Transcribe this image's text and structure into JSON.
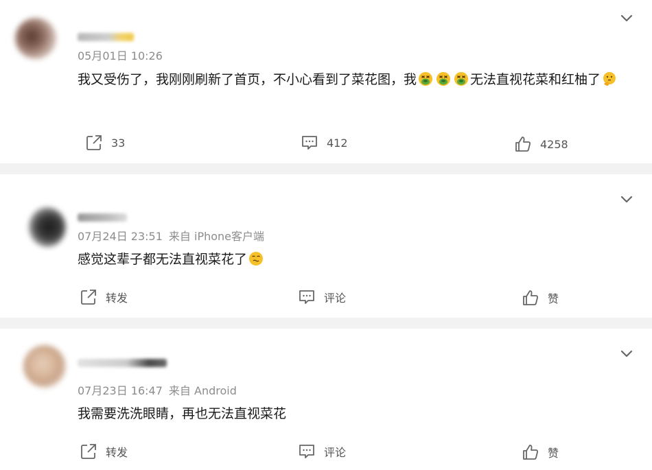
{
  "colors": {
    "separator": "#f2f2f2",
    "meta_text": "#8c8c8c",
    "action_text": "#555555",
    "icon_stroke": "#666666",
    "emoji_face": "#f5c02a",
    "emoji_sick": "#5aa83a"
  },
  "comments": [
    {
      "time": "05月01日 10:26",
      "source": "",
      "text_parts": [
        "我又受伤了，我刚刚刷新了首页，不小心看到了菜花图，我",
        "无法直视花菜和红柚了"
      ],
      "emojis": [
        "vomit-emoji",
        "vomit-emoji",
        "vomit-emoji",
        "thinking-emoji"
      ],
      "repost": "33",
      "comment": "412",
      "like": "4258"
    },
    {
      "time": "07月24日 23:51",
      "source": "来自 iPhone客户端",
      "text": "感觉这辈子都无法直视菜花了",
      "emojis": [
        "speechless-emoji"
      ],
      "repost": "转发",
      "comment": "评论",
      "like": "赞"
    },
    {
      "time": "07月23日 16:47",
      "source": "来自 Android",
      "text": "我需要洗洗眼睛，再也无法直视菜花",
      "repost": "转发",
      "comment": "评论",
      "like": "赞"
    }
  ]
}
